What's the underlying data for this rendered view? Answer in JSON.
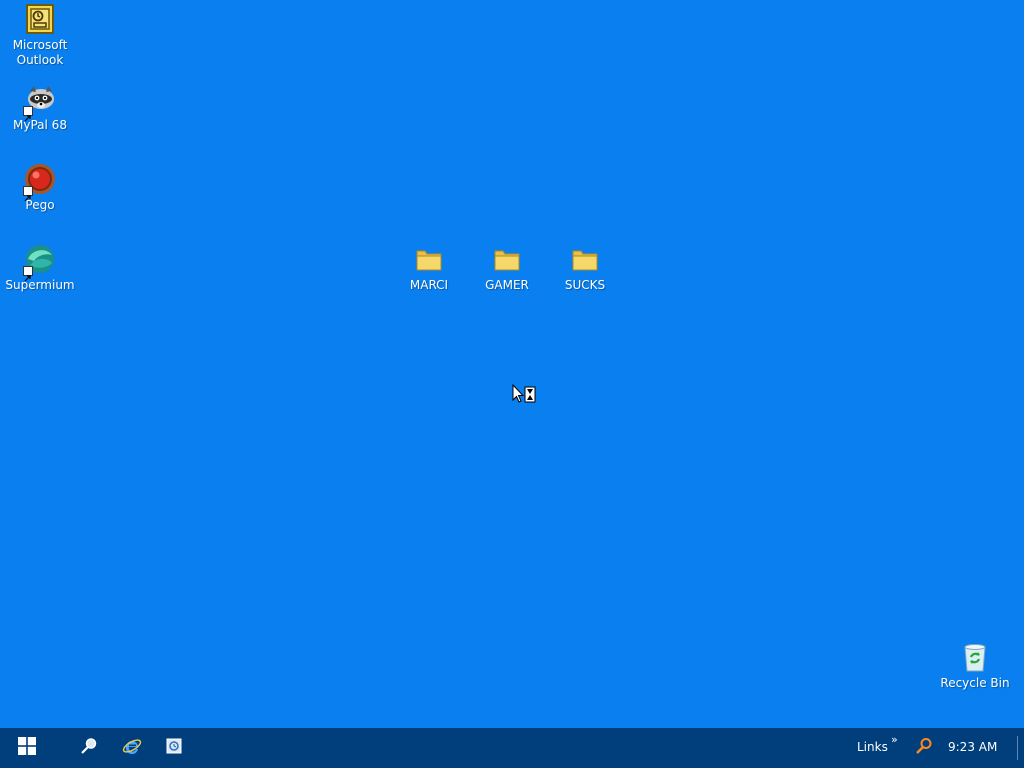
{
  "desktop": {
    "background": "#0a80f0",
    "icons": [
      {
        "label": "Microsoft\nOutlook",
        "icon": "outlook-icon"
      },
      {
        "label": "MyPal 68",
        "icon": "raccoon-icon"
      },
      {
        "label": "Pego",
        "icon": "red-ball-icon"
      },
      {
        "label": "Supermium",
        "icon": "supermium-icon"
      },
      {
        "label": "MARCI",
        "icon": "folder-icon"
      },
      {
        "label": "GAMER",
        "icon": "folder-icon"
      },
      {
        "label": "SUCKS",
        "icon": "folder-icon"
      },
      {
        "label": "Recycle Bin",
        "icon": "recycle-bin-icon"
      }
    ],
    "cursor": "busy-cursor-icon"
  },
  "taskbar": {
    "background": "#003e7c",
    "start_icon": "windows-logo-icon",
    "quick_launch": [
      "search-icon",
      "internet-explorer-icon",
      "outlook-express-icon"
    ],
    "links_label": "Links",
    "links_chevron": "»",
    "tray_search_icon": "search-orange-icon",
    "clock": "9:23 AM"
  }
}
